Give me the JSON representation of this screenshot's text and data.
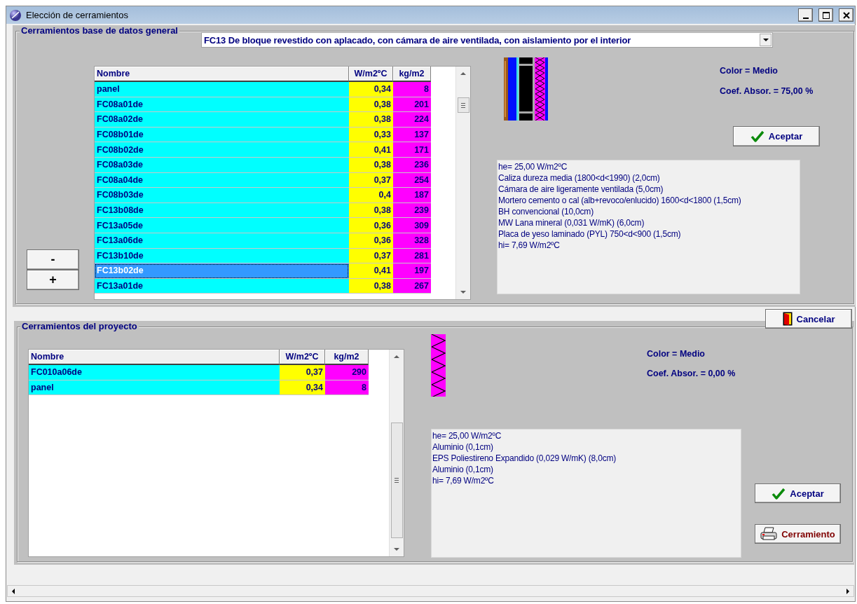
{
  "window": {
    "title": "Elección de cerramientos"
  },
  "database_group": {
    "title": "Cerramientos base de datos general",
    "selector": {
      "value": "FC13 De bloque revestido con aplacado, con cámara de aire ventilada, con aislamiento por el interior"
    },
    "step_buttons": [
      "-",
      "+"
    ],
    "table": {
      "columns": [
        "Nombre",
        "W/m2ºC",
        "kg/m2"
      ],
      "rows": [
        {
          "name": "panel",
          "u_value": "0,34",
          "weight": "8",
          "selected": false
        },
        {
          "name": "FC08a01de",
          "u_value": "0,38",
          "weight": "201",
          "selected": false
        },
        {
          "name": "FC08a02de",
          "u_value": "0,38",
          "weight": "224",
          "selected": false
        },
        {
          "name": "FC08b01de",
          "u_value": "0,33",
          "weight": "137",
          "selected": false
        },
        {
          "name": "FC08b02de",
          "u_value": "0,41",
          "weight": "171",
          "selected": false
        },
        {
          "name": "FC08a03de",
          "u_value": "0,38",
          "weight": "236",
          "selected": false
        },
        {
          "name": "FC08a04de",
          "u_value": "0,37",
          "weight": "254",
          "selected": false
        },
        {
          "name": "FC08b03de",
          "u_value": "0,4",
          "weight": "187",
          "selected": false
        },
        {
          "name": "FC13b08de",
          "u_value": "0,38",
          "weight": "239",
          "selected": false
        },
        {
          "name": "FC13a05de",
          "u_value": "0,36",
          "weight": "309",
          "selected": false
        },
        {
          "name": "FC13a06de",
          "u_value": "0,36",
          "weight": "328",
          "selected": false
        },
        {
          "name": "FC13b10de",
          "u_value": "0,37",
          "weight": "281",
          "selected": false
        },
        {
          "name": "FC13b02de",
          "u_value": "0,41",
          "weight": "197",
          "selected": true
        },
        {
          "name": "FC13a01de",
          "u_value": "0,38",
          "weight": "267",
          "selected": false
        }
      ]
    },
    "color_label": "Color = Medio",
    "absorption_label": "Coef. Absor. = 75,00 %",
    "accept_button": "Aceptar",
    "layers_text": [
      "he= 25,00 W/m2ºC",
      "Caliza dureza media (1800<d<1990) (2,0cm)",
      "Cámara de aire ligeramente ventilada (5,0cm)",
      "Mortero cemento o cal (alb+revoco/enlucido) 1600<d<1800 (1,5cm)",
      "BH convencional (10,0cm)",
      "MW Lana mineral (0,031 W/mK) (6,0cm)",
      "Placa de yeso laminado (PYL) 750<d<900 (1,5cm)",
      "hi= 7,69 W/m2ºC"
    ]
  },
  "cancel_button": "Cancelar",
  "project_group": {
    "title": "Cerramientos del proyecto",
    "table": {
      "columns": [
        "Nombre",
        "W/m2ºC",
        "kg/m2"
      ],
      "rows": [
        {
          "name": "FC010a06de",
          "u_value": "0,37",
          "weight": "290",
          "selected": false
        },
        {
          "name": "panel",
          "u_value": "0,34",
          "weight": "8",
          "selected": false
        }
      ]
    },
    "color_label": "Color = Medio",
    "absorption_label": "Coef. Absor. = 0,00 %",
    "accept_button": "Aceptar",
    "print_button": "Cerramiento",
    "layers_text": [
      "he= 25,00 W/m2ºC",
      "Aluminio (0,1cm)",
      "EPS Poliestireno Expandido (0,029 W/mK) (8,0cm)",
      "Aluminio (0,1cm)",
      "hi= 7,69 W/m2ºC"
    ]
  }
}
